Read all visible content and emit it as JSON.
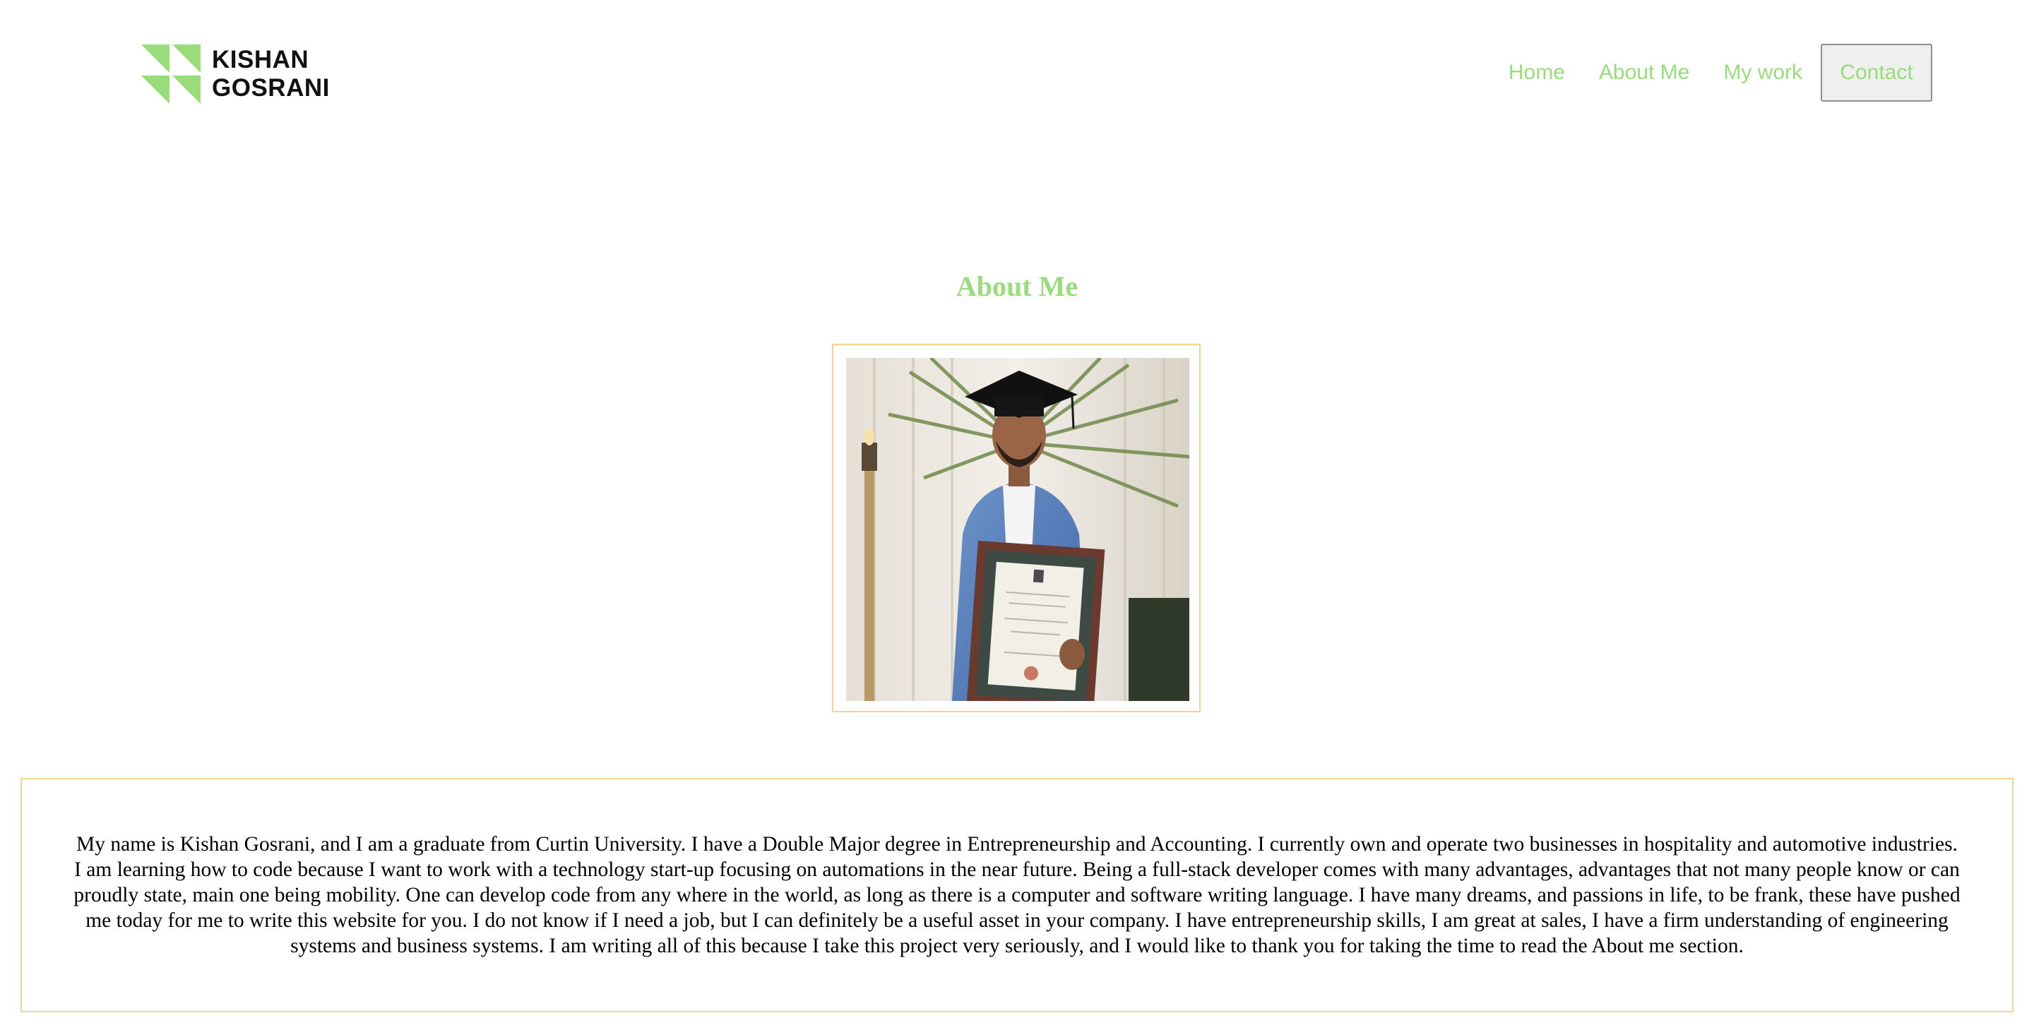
{
  "header": {
    "logo": {
      "line1": "KISHAN",
      "line2": "GOSRANI",
      "mark_icon": "triangle-grid-logo-icon",
      "mark_color": "#98dd7a"
    },
    "nav": {
      "items": [
        {
          "label": "Home"
        },
        {
          "label": "About Me"
        },
        {
          "label": "My work"
        }
      ],
      "contact_label": "Contact",
      "link_color": "#98dd7a"
    }
  },
  "about": {
    "title": "About Me",
    "photo_icon": "graduation-portrait-photo",
    "frame_color": "#f2d594",
    "bio": "My name is Kishan Gosrani, and I am a graduate from Curtin University. I have a Double Major degree in Entrepreneurship and Accounting. I currently own and operate two businesses in hospitality and automotive industries. I am learning how to code because I want to work with a technology start-up focusing on automations in the near future. Being a full-stack developer comes with many advantages, advantages that not many people know or can proudly state, main one being mobility. One can develop code from any where in the world, as long as there is a computer and software writing language. I have many dreams, and passions in life, to be frank, these have pushed me today for me to write this website for you. I do not know if I need a job, but I can definitely be a useful asset in your company. I have entrepreneurship skills, I am great at sales, I have a firm understanding of engineering systems and business systems. I am writing all of this because I take this project very seriously, and I would like to thank you for taking the time to read the About me section."
  }
}
